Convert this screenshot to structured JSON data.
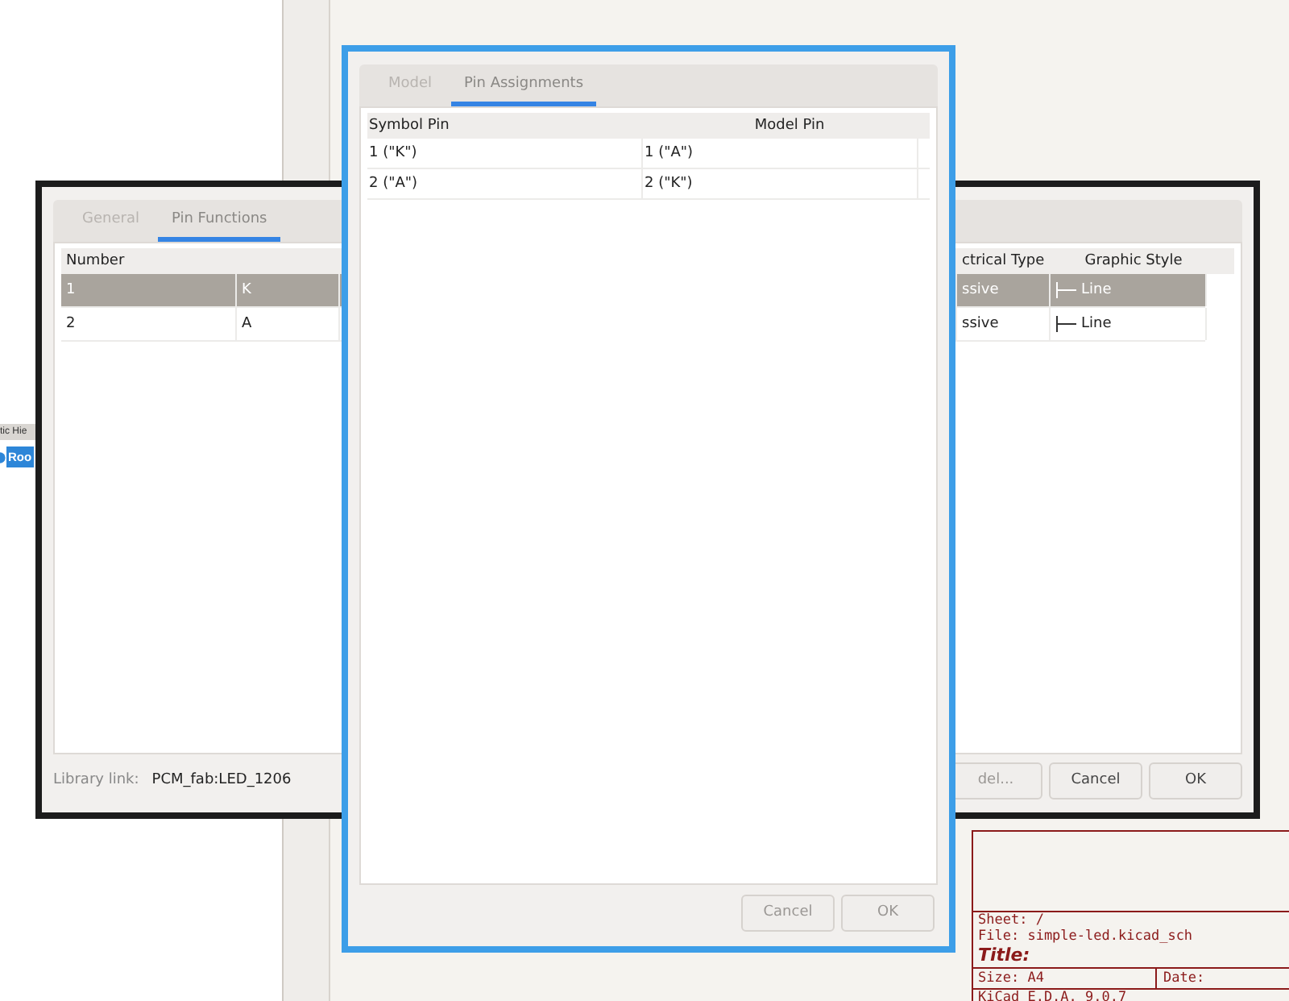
{
  "hierarchy": {
    "tab": "tic Hie",
    "item": {
      "label": "Roo",
      "selected": true
    }
  },
  "title_block": {
    "sheet": "Sheet: /",
    "file": "File: simple-led.kicad_sch",
    "title": "Title:",
    "size": "Size: A4",
    "date": "Date:",
    "generator": "KiCad E.D.A. 9.0.7"
  },
  "pin_dialog": {
    "tabs": [
      {
        "label": "General",
        "selected": false
      },
      {
        "label": "Pin Functions",
        "selected": true
      }
    ],
    "table": {
      "columns": [
        "Number",
        "ctrical Type",
        "Graphic Style"
      ],
      "rows": [
        {
          "number": "1",
          "name": "K",
          "type": "ssive",
          "style": "Line",
          "selected": true
        },
        {
          "number": "2",
          "name": "A",
          "type": "ssive",
          "style": "Line",
          "selected": false
        }
      ]
    },
    "library_label": "Library link:",
    "library_value": "PCM_fab:LED_1206",
    "buttons": [
      {
        "label": "del...",
        "disabled": true
      },
      {
        "label": "Cancel",
        "disabled": false
      },
      {
        "label": "OK",
        "disabled": false
      }
    ]
  },
  "model_dialog": {
    "tabs": [
      {
        "label": "Model",
        "selected": false
      },
      {
        "label": "Pin Assignments",
        "selected": true
      }
    ],
    "table": {
      "columns": [
        "Symbol Pin",
        "Model Pin"
      ],
      "rows": [
        {
          "symbol_pin": "1 (\"K\")",
          "model_pin": "1 (\"A\")"
        },
        {
          "symbol_pin": "2 (\"A\")",
          "model_pin": "2 (\"K\")"
        }
      ]
    },
    "buttons": [
      {
        "label": "Cancel",
        "disabled": true
      },
      {
        "label": "OK",
        "disabled": true
      }
    ]
  }
}
